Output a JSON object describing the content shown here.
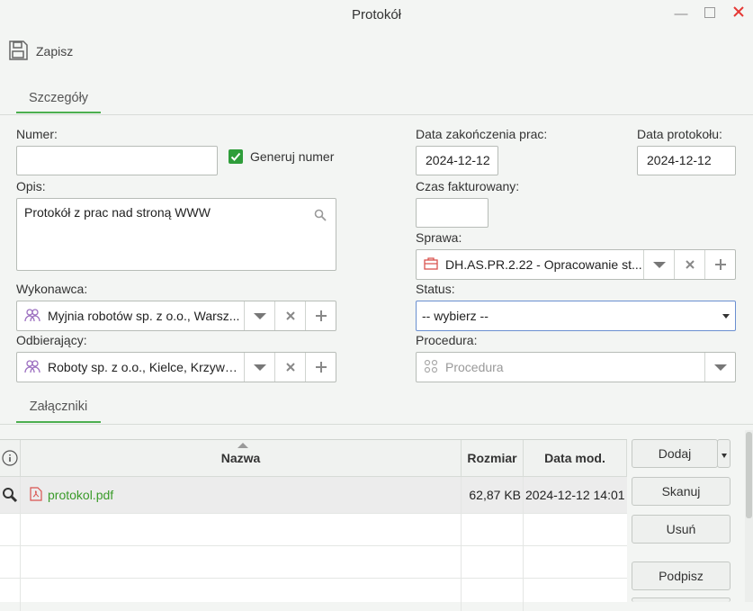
{
  "window": {
    "title": "Protokół"
  },
  "toolbar": {
    "save_label": "Zapisz"
  },
  "tabs": {
    "details": "Szczegóły",
    "attachments": "Załączniki"
  },
  "form": {
    "number": {
      "label": "Numer:",
      "value": ""
    },
    "generate_number": {
      "label": "Generuj numer",
      "checked": true
    },
    "description": {
      "label": "Opis:",
      "value": "Protokół z prac nad stroną WWW"
    },
    "contractor": {
      "label": "Wykonawca:",
      "value": "Myjnia robotów sp. z o.o., Warsz..."
    },
    "recipient": {
      "label": "Odbierający:",
      "value": "Roboty sp. z o.o., Kielce, Krzywa ..."
    },
    "work_end_date": {
      "label": "Data zakończenia prac:",
      "value": "2024-12-12"
    },
    "protocol_date": {
      "label": "Data protokołu:",
      "value": "2024-12-12"
    },
    "billed_time": {
      "label": "Czas fakturowany:",
      "value": ""
    },
    "case": {
      "label": "Sprawa:",
      "value": "DH.AS.PR.2.22 - Opracowanie st..."
    },
    "status": {
      "label": "Status:",
      "value": "-- wybierz --"
    },
    "procedure": {
      "label": "Procedura:",
      "placeholder": "Procedura"
    }
  },
  "attachments": {
    "columns": {
      "name": "Nazwa",
      "size": "Rozmiar",
      "modified": "Data mod."
    },
    "rows": [
      {
        "name": "protokol.pdf",
        "size": "62,87 KB",
        "modified": "2024-12-12 14:01"
      }
    ],
    "buttons": {
      "add": "Dodaj",
      "scan": "Skanuj",
      "remove": "Usuń",
      "sign": "Podpisz"
    }
  },
  "colors": {
    "accent": "#4caf50",
    "link": "#3a9b2a",
    "close": "#e53935",
    "pdf": "#d9534f",
    "person": "#9c6fc0"
  }
}
